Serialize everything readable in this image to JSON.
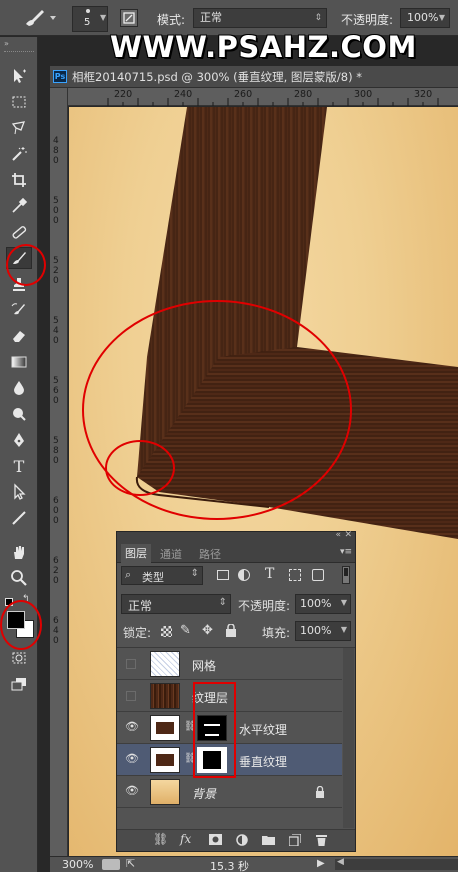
{
  "options_bar": {
    "brush_size": "5",
    "mode_label": "模式:",
    "mode_value": "正常",
    "opacity_label": "不透明度:",
    "opacity_value": "100%"
  },
  "watermark": "WWW.PSAHZ.COM",
  "document": {
    "tab_title": "相框20140715.psd @ 300% (垂直纹理, 图层蒙版/8) *",
    "ruler_ticks": [
      "220",
      "240",
      "260",
      "280",
      "300",
      "320"
    ],
    "vertical_ruler_ticks": [
      "4",
      "8",
      "0",
      "5",
      "0",
      "0",
      "5",
      "2",
      "0",
      "5",
      "4",
      "0",
      "5",
      "6",
      "0",
      "5",
      "8",
      "0",
      "6",
      "0",
      "0",
      "6",
      "2",
      "0",
      "6",
      "4",
      "0",
      "6",
      "6",
      "0",
      "6",
      "8",
      "0",
      "7",
      "0",
      "0"
    ]
  },
  "status_bar": {
    "zoom": "300%",
    "timing": "15.3 秒"
  },
  "layers_panel": {
    "tabs": [
      "图层",
      "通道",
      "路径"
    ],
    "filter_kind": "类型",
    "blend_mode": "正常",
    "opacity_label": "不透明度:",
    "opacity_value": "100%",
    "lock_label": "锁定:",
    "fill_label": "填充:",
    "fill_value": "100%",
    "layers": [
      {
        "name": "网格",
        "visible": false
      },
      {
        "name": "纹理层",
        "visible": false
      },
      {
        "name": "水平纹理",
        "visible": true
      },
      {
        "name": "垂直纹理",
        "visible": true,
        "selected": true
      },
      {
        "name": "背景",
        "visible": true,
        "locked": true
      }
    ]
  },
  "colors": {
    "highlight_red": "#e00000",
    "selected_layer": "#4f5b74",
    "wood_dark": "#4a2614"
  }
}
